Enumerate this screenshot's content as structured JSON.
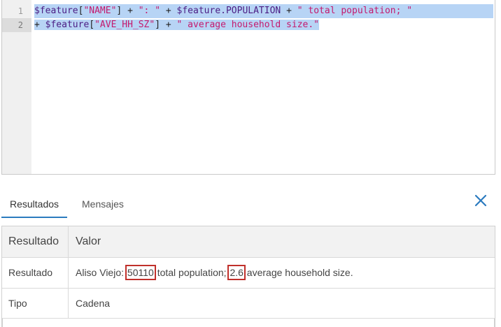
{
  "editor": {
    "line_numbers": [
      "1",
      "2"
    ],
    "line1": {
      "t1": "$feature",
      "t2": "[",
      "t3": "\"NAME\"",
      "t4": "] + ",
      "t5": "\": \"",
      "t6": " + ",
      "t7": "$feature.POPULATION",
      "t8": " + ",
      "t9": "\" total population; \""
    },
    "line2": {
      "t1": "+ ",
      "t2": "$feature",
      "t3": "[",
      "t4": "\"AVE_HH_SZ\"",
      "t5": "] + ",
      "t6": "\" average household size.\""
    }
  },
  "tabs": [
    {
      "label": "Resultados",
      "active": true
    },
    {
      "label": "Mensajes",
      "active": false
    }
  ],
  "close_icon": "close-icon",
  "table": {
    "headers": [
      "Resultado",
      "Valor"
    ],
    "rows": [
      {
        "key": "Resultado",
        "value_prefix": "Aliso Viejo: ",
        "value_highlight1": "50110",
        "value_mid": " total population; ",
        "value_highlight2": "2.6",
        "value_suffix": " average household size."
      },
      {
        "key": "Tipo",
        "value": "Cadena"
      }
    ]
  },
  "colors": {
    "accent": "#2b7bbf",
    "selection": "#b7d4f5",
    "highlight_box": "#c0302b",
    "string": "#c41a6e",
    "variable": "#4b1d84"
  }
}
